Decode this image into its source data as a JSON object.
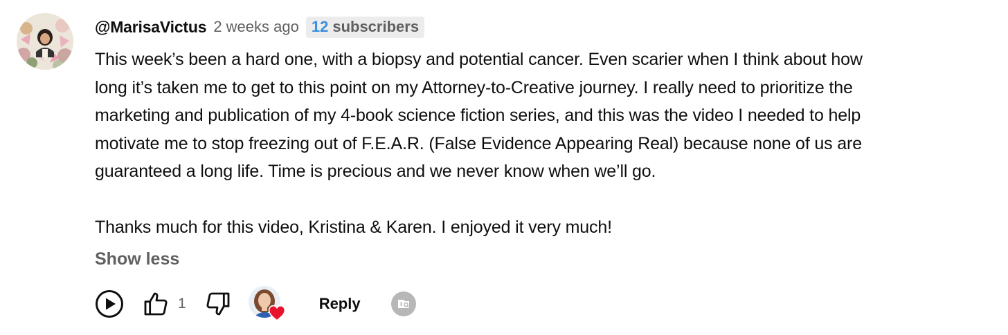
{
  "comment": {
    "author": "@MarisaVictus",
    "time": "2 weeks ago",
    "badge": {
      "count": "12",
      "label": "subscribers"
    },
    "paragraphs": [
      [
        "This week’s been a hard one, with a biopsy and potential cancer. Even scarier when I think about how",
        "long it’s taken me to get to this point on my Attorney-to-Creative journey. I really need to prioritize the",
        "marketing and publication of my 4-book science fiction series, and this was the video I needed to help",
        "motivate me to stop freezing out of F.E.A.R. (False Evidence Appearing Real) because none of us are",
        "guaranteed a long life. Time is precious and we never know when we’ll go."
      ],
      [
        "Thanks much for this video, Kristina & Karen. I enjoyed it very much!"
      ]
    ],
    "show_less": "Show less"
  },
  "actions": {
    "like_count": "1",
    "reply_label": "Reply"
  },
  "colors": {
    "badge_count": "#3a8fe0",
    "heart": "#e8142c",
    "secondary_text": "#606060"
  },
  "icons": {
    "play": "play-circle-icon",
    "like": "thumbs-up-icon",
    "dislike": "thumbs-down-icon",
    "heart": "heart-icon",
    "translate": "translate-icon"
  }
}
